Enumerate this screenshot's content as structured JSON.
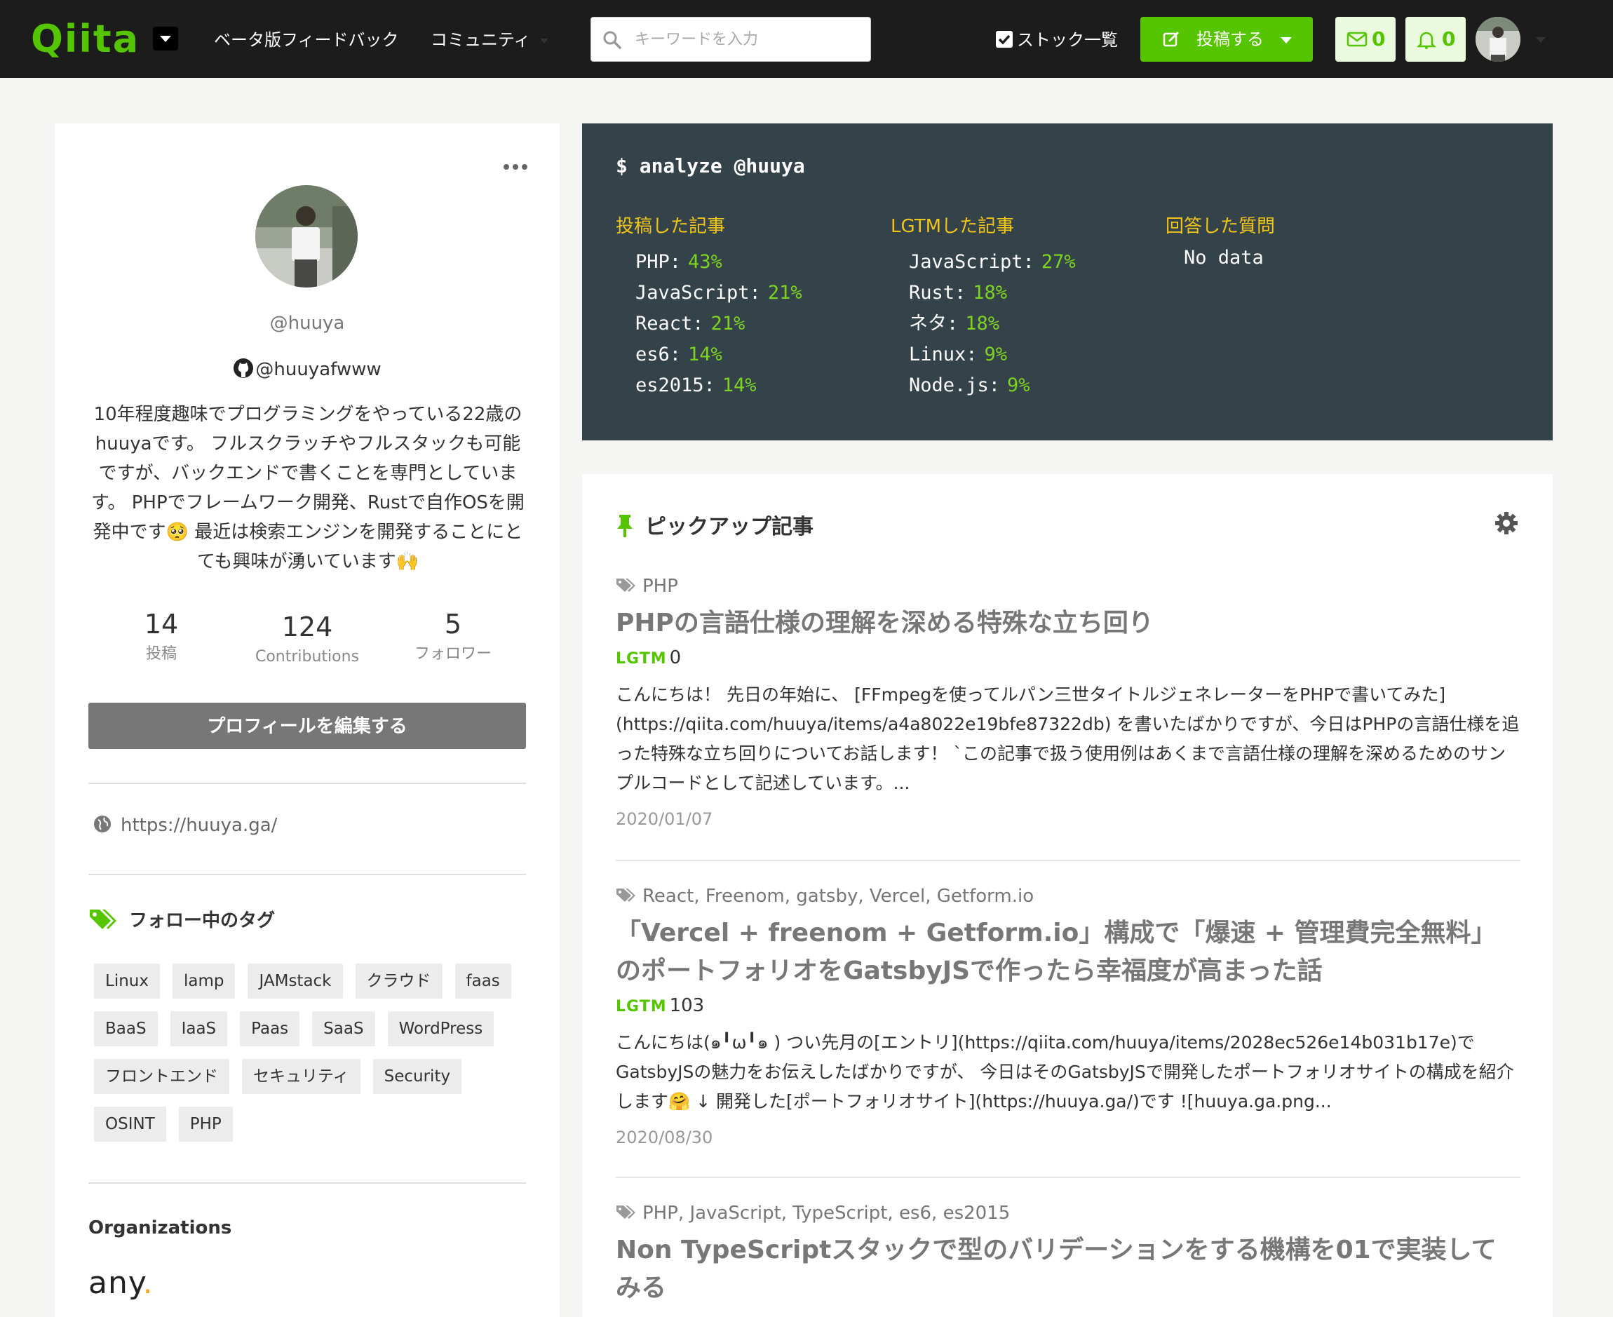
{
  "header": {
    "logo": "Qiita",
    "nav": [
      "ベータ版フィードバック",
      "コミュニティ"
    ],
    "search_placeholder": "キーワードを入力",
    "stock_label": "ストック一覧",
    "post_label": "投稿する",
    "mail_count": "0",
    "bell_count": "0",
    "colors": {
      "bg": "#1c1c1c",
      "accent": "#55c500"
    }
  },
  "profile": {
    "username": "@huuya",
    "github": "@huuyafwww",
    "bio": "10年程度趣味でプログラミングをやっている22歳のhuuyaです。 フルスクラッチやフルスタックも可能ですが、バックエンドで書くことを専門としています。 PHPでフレームワーク開発、Rustで自作OSを開発中です🥺 最近は検索エンジンを開発することにとても興味が湧いています🙌",
    "stats": [
      {
        "value": "14",
        "label": "投稿"
      },
      {
        "value": "124",
        "label": "Contributions"
      },
      {
        "value": "5",
        "label": "フォロワー"
      }
    ],
    "edit_button": "プロフィールを編集する",
    "website": "https://huuya.ga/",
    "tags_title": "フォロー中のタグ",
    "tags": [
      "Linux",
      "lamp",
      "JAMstack",
      "クラウド",
      "faas",
      "BaaS",
      "IaaS",
      "Paas",
      "SaaS",
      "WordPress",
      "フロントエンド",
      "セキュリティ",
      "Security",
      "OSINT",
      "PHP"
    ],
    "org_title": "Organizations",
    "org_name": "any",
    "org_dot": "."
  },
  "analyze": {
    "command": "$ analyze @huuya",
    "columns": [
      {
        "title": "投稿した記事",
        "items": [
          {
            "name": "PHP:",
            "pct": "43%"
          },
          {
            "name": "JavaScript:",
            "pct": "21%"
          },
          {
            "name": "React:",
            "pct": "21%"
          },
          {
            "name": "es6:",
            "pct": "14%"
          },
          {
            "name": "es2015:",
            "pct": "14%"
          }
        ]
      },
      {
        "title": "LGTMした記事",
        "items": [
          {
            "name": "JavaScript:",
            "pct": "27%"
          },
          {
            "name": "Rust:",
            "pct": "18%"
          },
          {
            "name": "ネタ:",
            "pct": "18%"
          },
          {
            "name": "Linux:",
            "pct": "9%"
          },
          {
            "name": "Node.js:",
            "pct": "9%"
          }
        ]
      },
      {
        "title": "回答した質問",
        "empty": "No data"
      }
    ]
  },
  "pickup": {
    "title": "ピックアップ記事",
    "lgtm_label": "LGTM",
    "articles": [
      {
        "tags": "PHP",
        "title": "PHPの言語仕様の理解を深める特殊な立ち回り",
        "lgtm": "0",
        "body": "こんにちは！ 先日の年始に、 [FFmpegを使ってルパン三世タイトルジェネレーターをPHPで書いてみた](https://qiita.com/huuya/items/a4a8022e19bfe87322db) を書いたばかりですが、今日はPHPの言語仕様を追った特殊な立ち回りについてお話します！ `この記事で扱う使用例はあくまで言語仕様の理解を深めるためのサンプルコードとして記述しています。...",
        "date": "2020/01/07"
      },
      {
        "tags": "React,  Freenom,  gatsby,  Vercel,  Getform.io",
        "title": "「Vercel + freenom + Getform.io」構成で「爆速 + 管理費完全無料」のポートフォリオをGatsbyJSで作ったら幸福度が高まった話",
        "lgtm": "103",
        "body": "こんにちは(๑╹ω╹๑ ) つい先月の[エントリ](https://qiita.com/huuya/items/2028ec526e14b031b17e)でGatsbyJSの魅力をお伝えしたばかりですが、 今日はそのGatsbyJSで開発したポートフォリオサイトの構成を紹介します🤗 ↓ 開発した[ポートフォリオサイト](https://huuya.ga/)です ![huuya.ga.png...",
        "date": "2020/08/30"
      },
      {
        "tags": "PHP,  JavaScript,  TypeScript,  es6,  es2015",
        "title": "Non TypeScriptスタックで型のバリデーションをする機構を01で実装してみる"
      }
    ]
  }
}
